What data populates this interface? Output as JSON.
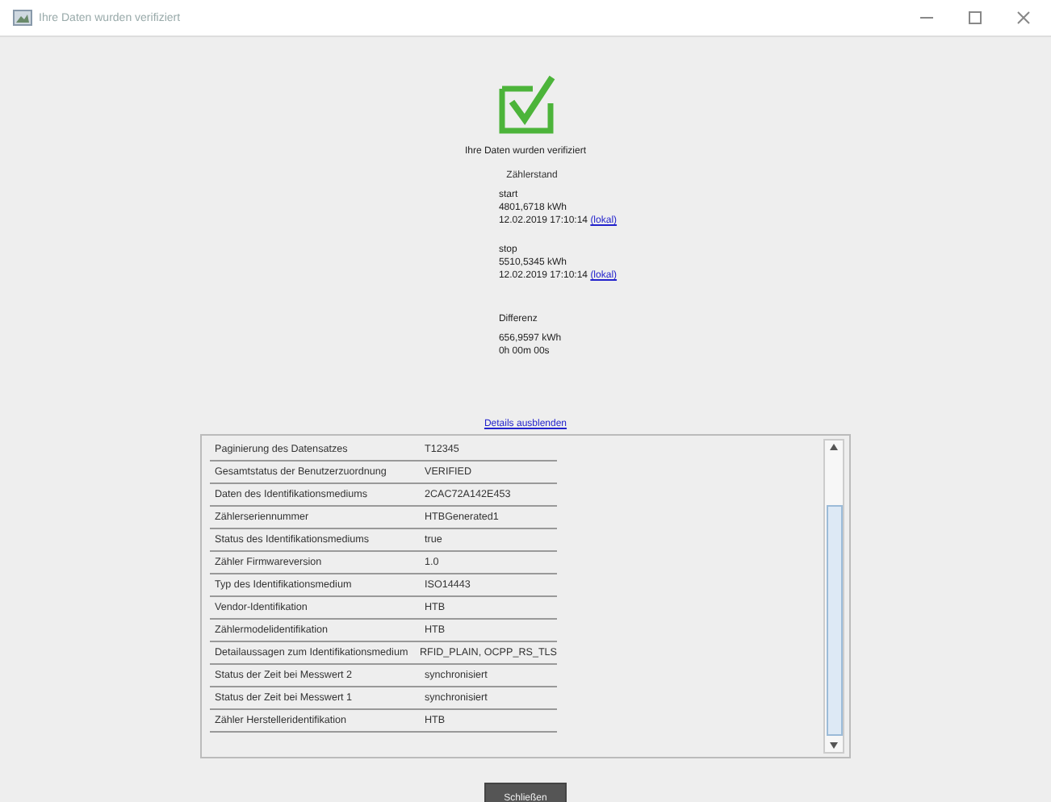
{
  "window": {
    "title": "Ihre Daten wurden verifiziert"
  },
  "status": {
    "message": "Ihre Daten wurden verifiziert",
    "verified": true
  },
  "meter": {
    "heading": "Zählerstand",
    "readings": [
      {
        "label": "start",
        "value": "4801,6718 kWh",
        "time": "12.02.2019 17:10:14",
        "zone": "(lokal)"
      },
      {
        "label": "stop",
        "value": "5510,5345 kWh",
        "time": "12.02.2019 17:10:14",
        "zone": "(lokal)"
      }
    ],
    "difference": {
      "label": "Differenz",
      "value": "656,9597 kWh",
      "duration": "0h 00m 00s"
    }
  },
  "details_link": "Details ausblenden",
  "table": {
    "rows": [
      {
        "name": "Paginierung des Datensatzes",
        "value": "T12345"
      },
      {
        "name": "Gesamtstatus der Benutzerzuordnung",
        "value": "VERIFIED"
      },
      {
        "name": "Daten des Identifikationsmediums",
        "value": "2CAC72A142E453"
      },
      {
        "name": "Zählerseriennummer",
        "value": "HTBGenerated1"
      },
      {
        "name": "Status des Identifikationsmediums",
        "value": "true"
      },
      {
        "name": "Zähler Firmwareversion",
        "value": "1.0"
      },
      {
        "name": "Typ des Identifikationsmedium",
        "value": "ISO14443"
      },
      {
        "name": "Vendor-Identifikation",
        "value": "HTB"
      },
      {
        "name": "Zählermodelidentifikation",
        "value": "HTB"
      },
      {
        "name": "Detailaussagen zum Identifikationsmedium",
        "value": "RFID_PLAIN, OCPP_RS_TLS"
      },
      {
        "name": "Status der Zeit bei Messwert 2",
        "value": "synchronisiert"
      },
      {
        "name": "Status der Zeit bei Messwert 1",
        "value": "synchronisiert"
      },
      {
        "name": "Zähler Herstelleridentifikation",
        "value": "HTB"
      }
    ]
  },
  "buttons": [
    "Schließen"
  ]
}
